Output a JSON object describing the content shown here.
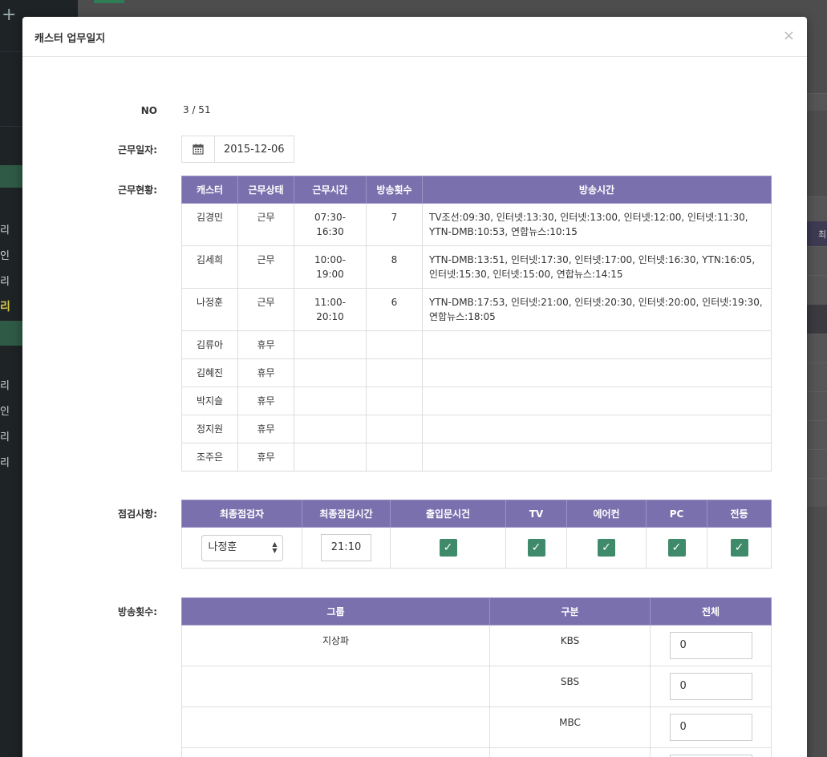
{
  "background": {
    "right_head_text": "최",
    "menu_items": [
      {
        "text": "리",
        "top": 0
      },
      {
        "text": "인",
        "top": 0
      },
      {
        "text": "리",
        "top": 0
      },
      {
        "text": "리",
        "top": 0
      },
      {
        "text": "리",
        "top": 0
      },
      {
        "text": "인",
        "top": 0
      },
      {
        "text": "리",
        "top": 0
      },
      {
        "text": "리",
        "top": 0
      }
    ]
  },
  "modal": {
    "title": "캐스터 업무일지",
    "close": "×"
  },
  "form": {
    "no_label": "NO",
    "no_value": "3 / 51",
    "date_label": "근무일자:",
    "date_value": "2015-12-06",
    "status_label": "근무현황:",
    "check_label": "점검사항:",
    "broadcast_label": "방송횟수:"
  },
  "work_table": {
    "headers": [
      "캐스터",
      "근무상태",
      "근무시간",
      "방송횟수",
      "방송시간"
    ],
    "rows": [
      {
        "caster": "김경민",
        "status": "근무",
        "hours": "07:30-16:30",
        "count": "7",
        "times": "TV조선:09:30, 인터넷:13:30, 인터넷:13:00, 인터넷:12:00, 인터넷:11:30, YTN-DMB:10:53, 연합뉴스:10:15"
      },
      {
        "caster": "김세희",
        "status": "근무",
        "hours": "10:00-19:00",
        "count": "8",
        "times": "YTN-DMB:13:51, 인터넷:17:30, 인터넷:17:00, 인터넷:16:30, YTN:16:05, 인터넷:15:30, 인터넷:15:00, 연합뉴스:14:15"
      },
      {
        "caster": "나정훈",
        "status": "근무",
        "hours": "11:00-20:10",
        "count": "6",
        "times": "YTN-DMB:17:53, 인터넷:21:00, 인터넷:20:30, 인터넷:20:00, 인터넷:19:30, 연합뉴스:18:05"
      },
      {
        "caster": "김류아",
        "status": "휴무",
        "hours": "",
        "count": "",
        "times": ""
      },
      {
        "caster": "김혜진",
        "status": "휴무",
        "hours": "",
        "count": "",
        "times": ""
      },
      {
        "caster": "박지슬",
        "status": "휴무",
        "hours": "",
        "count": "",
        "times": ""
      },
      {
        "caster": "정지원",
        "status": "휴무",
        "hours": "",
        "count": "",
        "times": ""
      },
      {
        "caster": "조주은",
        "status": "휴무",
        "hours": "",
        "count": "",
        "times": ""
      }
    ]
  },
  "check_table": {
    "headers": [
      "최종점검자",
      "최종점검시간",
      "출입문시건",
      "TV",
      "에어컨",
      "PC",
      "전등"
    ],
    "inspector": "나정훈",
    "time": "21:10",
    "checks": {
      "door": true,
      "tv": true,
      "aircon": true,
      "pc": true,
      "light": true
    },
    "check_mark": "✓"
  },
  "broadcast_table": {
    "headers": [
      "그룹",
      "구분",
      "전체"
    ],
    "rows": [
      {
        "group": "지상파",
        "type": "KBS",
        "total": "0"
      },
      {
        "group": "",
        "type": "SBS",
        "total": "0"
      },
      {
        "group": "",
        "type": "MBC",
        "total": "0"
      },
      {
        "group": "",
        "type": "",
        "total": ""
      }
    ]
  }
}
